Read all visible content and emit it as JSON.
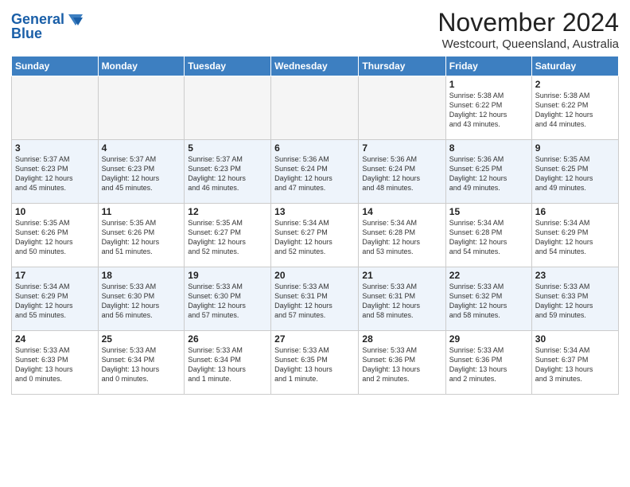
{
  "logo": {
    "line1": "General",
    "line2": "Blue"
  },
  "title": "November 2024",
  "location": "Westcourt, Queensland, Australia",
  "days_of_week": [
    "Sunday",
    "Monday",
    "Tuesday",
    "Wednesday",
    "Thursday",
    "Friday",
    "Saturday"
  ],
  "weeks": [
    [
      {
        "day": "",
        "info": ""
      },
      {
        "day": "",
        "info": ""
      },
      {
        "day": "",
        "info": ""
      },
      {
        "day": "",
        "info": ""
      },
      {
        "day": "",
        "info": ""
      },
      {
        "day": "1",
        "info": "Sunrise: 5:38 AM\nSunset: 6:22 PM\nDaylight: 12 hours\nand 43 minutes."
      },
      {
        "day": "2",
        "info": "Sunrise: 5:38 AM\nSunset: 6:22 PM\nDaylight: 12 hours\nand 44 minutes."
      }
    ],
    [
      {
        "day": "3",
        "info": "Sunrise: 5:37 AM\nSunset: 6:23 PM\nDaylight: 12 hours\nand 45 minutes."
      },
      {
        "day": "4",
        "info": "Sunrise: 5:37 AM\nSunset: 6:23 PM\nDaylight: 12 hours\nand 45 minutes."
      },
      {
        "day": "5",
        "info": "Sunrise: 5:37 AM\nSunset: 6:23 PM\nDaylight: 12 hours\nand 46 minutes."
      },
      {
        "day": "6",
        "info": "Sunrise: 5:36 AM\nSunset: 6:24 PM\nDaylight: 12 hours\nand 47 minutes."
      },
      {
        "day": "7",
        "info": "Sunrise: 5:36 AM\nSunset: 6:24 PM\nDaylight: 12 hours\nand 48 minutes."
      },
      {
        "day": "8",
        "info": "Sunrise: 5:36 AM\nSunset: 6:25 PM\nDaylight: 12 hours\nand 49 minutes."
      },
      {
        "day": "9",
        "info": "Sunrise: 5:35 AM\nSunset: 6:25 PM\nDaylight: 12 hours\nand 49 minutes."
      }
    ],
    [
      {
        "day": "10",
        "info": "Sunrise: 5:35 AM\nSunset: 6:26 PM\nDaylight: 12 hours\nand 50 minutes."
      },
      {
        "day": "11",
        "info": "Sunrise: 5:35 AM\nSunset: 6:26 PM\nDaylight: 12 hours\nand 51 minutes."
      },
      {
        "day": "12",
        "info": "Sunrise: 5:35 AM\nSunset: 6:27 PM\nDaylight: 12 hours\nand 52 minutes."
      },
      {
        "day": "13",
        "info": "Sunrise: 5:34 AM\nSunset: 6:27 PM\nDaylight: 12 hours\nand 52 minutes."
      },
      {
        "day": "14",
        "info": "Sunrise: 5:34 AM\nSunset: 6:28 PM\nDaylight: 12 hours\nand 53 minutes."
      },
      {
        "day": "15",
        "info": "Sunrise: 5:34 AM\nSunset: 6:28 PM\nDaylight: 12 hours\nand 54 minutes."
      },
      {
        "day": "16",
        "info": "Sunrise: 5:34 AM\nSunset: 6:29 PM\nDaylight: 12 hours\nand 54 minutes."
      }
    ],
    [
      {
        "day": "17",
        "info": "Sunrise: 5:34 AM\nSunset: 6:29 PM\nDaylight: 12 hours\nand 55 minutes."
      },
      {
        "day": "18",
        "info": "Sunrise: 5:33 AM\nSunset: 6:30 PM\nDaylight: 12 hours\nand 56 minutes."
      },
      {
        "day": "19",
        "info": "Sunrise: 5:33 AM\nSunset: 6:30 PM\nDaylight: 12 hours\nand 57 minutes."
      },
      {
        "day": "20",
        "info": "Sunrise: 5:33 AM\nSunset: 6:31 PM\nDaylight: 12 hours\nand 57 minutes."
      },
      {
        "day": "21",
        "info": "Sunrise: 5:33 AM\nSunset: 6:31 PM\nDaylight: 12 hours\nand 58 minutes."
      },
      {
        "day": "22",
        "info": "Sunrise: 5:33 AM\nSunset: 6:32 PM\nDaylight: 12 hours\nand 58 minutes."
      },
      {
        "day": "23",
        "info": "Sunrise: 5:33 AM\nSunset: 6:33 PM\nDaylight: 12 hours\nand 59 minutes."
      }
    ],
    [
      {
        "day": "24",
        "info": "Sunrise: 5:33 AM\nSunset: 6:33 PM\nDaylight: 13 hours\nand 0 minutes."
      },
      {
        "day": "25",
        "info": "Sunrise: 5:33 AM\nSunset: 6:34 PM\nDaylight: 13 hours\nand 0 minutes."
      },
      {
        "day": "26",
        "info": "Sunrise: 5:33 AM\nSunset: 6:34 PM\nDaylight: 13 hours\nand 1 minute."
      },
      {
        "day": "27",
        "info": "Sunrise: 5:33 AM\nSunset: 6:35 PM\nDaylight: 13 hours\nand 1 minute."
      },
      {
        "day": "28",
        "info": "Sunrise: 5:33 AM\nSunset: 6:36 PM\nDaylight: 13 hours\nand 2 minutes."
      },
      {
        "day": "29",
        "info": "Sunrise: 5:33 AM\nSunset: 6:36 PM\nDaylight: 13 hours\nand 2 minutes."
      },
      {
        "day": "30",
        "info": "Sunrise: 5:34 AM\nSunset: 6:37 PM\nDaylight: 13 hours\nand 3 minutes."
      }
    ]
  ]
}
